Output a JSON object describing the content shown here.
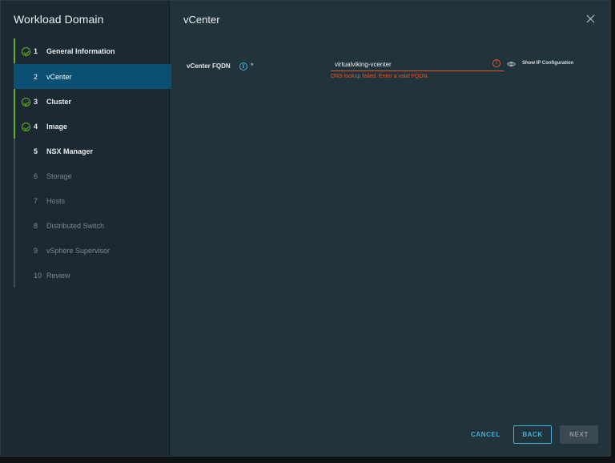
{
  "wizard": {
    "title": "Workload Domain",
    "steps": [
      {
        "num": "1",
        "label": "General Information",
        "state": "completed"
      },
      {
        "num": "2",
        "label": "vCenter",
        "state": "active"
      },
      {
        "num": "3",
        "label": "Cluster",
        "state": "completed"
      },
      {
        "num": "4",
        "label": "Image",
        "state": "completed"
      },
      {
        "num": "5",
        "label": "NSX Manager",
        "state": "enabled"
      },
      {
        "num": "6",
        "label": "Storage",
        "state": "disabled"
      },
      {
        "num": "7",
        "label": "Hosts",
        "state": "disabled"
      },
      {
        "num": "8",
        "label": "Distributed Switch",
        "state": "disabled"
      },
      {
        "num": "9",
        "label": "vSphere Supervisor",
        "state": "disabled"
      },
      {
        "num": "10",
        "label": "Review",
        "state": "disabled"
      }
    ]
  },
  "main": {
    "title": "vCenter",
    "fqdn": {
      "label": "vCenter FQDN",
      "required_marker": "*",
      "value": "virtualviking-vcenter",
      "error": "DNS lookup failed. Enter a valid FQDN.",
      "info_icon": "i",
      "error_icon": "!"
    },
    "show_ip_label": "Show IP Configuration"
  },
  "buttons": {
    "cancel": "CANCEL",
    "back": "BACK",
    "next": "NEXT"
  },
  "colors": {
    "accent": "#49afd9",
    "active_step_bg": "#0b4f73",
    "completed": "#60b515",
    "error": "#e0592a",
    "dialog_bg": "#21333b",
    "sidebar_bg": "#1b2a32"
  },
  "icons": {
    "close": "close-icon",
    "check": "check-circle-icon",
    "info": "info-icon",
    "error": "exclamation-circle-icon",
    "eye": "eye-icon"
  }
}
